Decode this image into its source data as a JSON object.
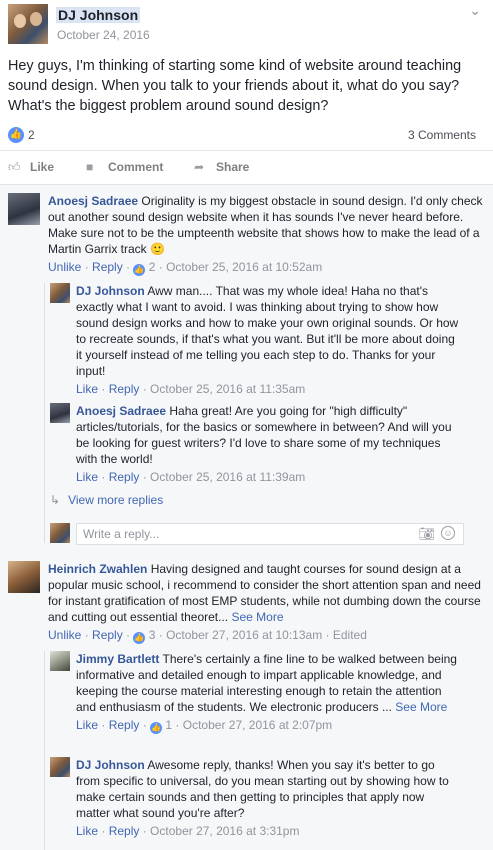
{
  "post": {
    "author": "DJ Johnson",
    "date": "October 24, 2016",
    "text": "Hey guys, I'm thinking of starting some kind of website around teaching sound design. When you talk to your friends about it, what do you say? What's the biggest problem around sound design?",
    "like_count": "2",
    "comment_count": "3 Comments"
  },
  "actions": {
    "like": "Like",
    "comment": "Comment",
    "share": "Share"
  },
  "comments": [
    {
      "author": "Anoesj Sadraee",
      "text": "Originality is my biggest obstacle in sound design. I'd only check out another sound design website when it has sounds I've never heard before. Make sure not to be the umpteenth website that shows how to make the lead of a Martin Garrix track 🙂",
      "unlike": "Unlike",
      "reply": "Reply",
      "likes": "2",
      "time": "October 25, 2016 at 10:52am",
      "replies": [
        {
          "author": "DJ Johnson",
          "text": "Aww man.... That was my whole idea! Haha no that's exactly what I want to avoid. I was thinking about trying to show how sound design works and how to make your own original sounds. Or how to recreate sounds, if that's what you want. But it'll be more about doing it yourself instead of me telling you each step to do. Thanks for your input!",
          "like": "Like",
          "reply": "Reply",
          "time": "October 25, 2016 at 11:35am"
        },
        {
          "author": "Anoesj Sadraee",
          "text": "Haha great! Are you going for \"high difficulty\" articles/tutorials, for the basics or somewhere in between? And will you be looking for guest writers? I'd love to share some of my techniques with the world!",
          "like": "Like",
          "reply": "Reply",
          "time": "October 25, 2016 at 11:39am"
        }
      ],
      "view_more": "View more replies",
      "reply_placeholder": "Write a reply..."
    },
    {
      "author": "Heinrich Zwahlen",
      "text": "Having designed and taught courses for sound design at a popular music school, i recommend to consider the short attention span and need for instant gratification of most EMP students, while not dumbing down the course and cutting out essential theoret...",
      "see_more": "See More",
      "unlike": "Unlike",
      "reply": "Reply",
      "likes": "3",
      "time": "October 27, 2016 at 10:13am",
      "edited": "Edited",
      "replies": [
        {
          "author": "Jimmy Bartlett",
          "text": "There's certainly a fine line to be walked between being informative and detailed enough to impart applicable knowledge, and keeping the course material interesting enough to retain the attention and enthusiasm of the students. We electronic producers ...",
          "see_more": "See More",
          "like": "Like",
          "reply": "Reply",
          "likes": "1",
          "time": "October 27, 2016 at 2:07pm"
        },
        {
          "author": "DJ Johnson",
          "text": "Awesome reply, thanks! When you say it's better to go from specific to universal, do you mean starting out by showing how to make certain sounds and then getting to principles that apply now matter what sound you're after?",
          "like": "Like",
          "reply": "Reply",
          "time": "October 27, 2016 at 3:31pm"
        }
      ]
    }
  ],
  "icons": {
    "like": "thumbs-up-icon",
    "comment": "speech-bubble-icon",
    "share": "share-arrow-icon",
    "camera": "camera-icon",
    "emoji": "smiley-icon",
    "options": "chevron-down-icon"
  },
  "colors": {
    "link": "#365899",
    "accent": "#4267b2",
    "like_blue": "#5890ff",
    "muted": "#90949c"
  }
}
